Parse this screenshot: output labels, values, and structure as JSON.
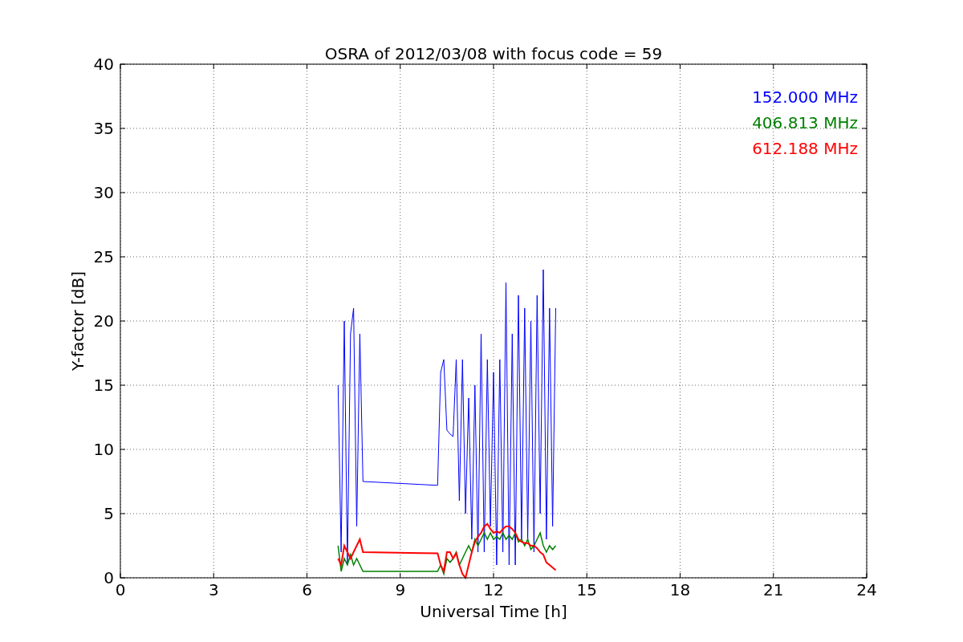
{
  "chart_data": {
    "type": "line",
    "title": "OSRA of 2012/03/08 with focus code = 59",
    "xlabel": "Universal Time [h]",
    "ylabel": "Y-factor [dB]",
    "x": [
      7.0,
      7.1,
      7.2,
      7.3,
      7.4,
      7.5,
      7.6,
      7.7,
      7.8,
      10.2,
      10.3,
      10.4,
      10.5,
      10.6,
      10.7,
      10.8,
      10.9,
      11.0,
      11.1,
      11.2,
      11.3,
      11.4,
      11.5,
      11.6,
      11.7,
      11.8,
      11.9,
      12.0,
      12.1,
      12.2,
      12.3,
      12.4,
      12.5,
      12.6,
      12.7,
      12.8,
      12.9,
      13.0,
      13.1,
      13.2,
      13.3,
      13.4,
      13.5,
      13.6,
      13.7,
      13.8,
      13.9,
      14.0
    ],
    "series": [
      {
        "name": "152.000 MHz",
        "color": "#0000ff",
        "values": [
          15,
          2,
          20,
          1,
          19,
          21,
          4,
          19,
          7.5,
          7.2,
          16,
          17,
          11.5,
          11.2,
          11,
          17,
          6,
          17,
          5,
          14,
          3,
          15,
          2,
          19,
          2,
          17,
          4,
          16,
          1,
          17,
          2,
          23,
          1,
          19,
          1,
          22,
          3,
          21,
          3,
          20,
          2,
          22,
          5,
          24,
          3,
          21,
          4,
          21
        ]
      },
      {
        "name": "406.813 MHz",
        "color": "#008000",
        "values": [
          2.5,
          0.5,
          1.5,
          1,
          1.8,
          1,
          1.5,
          1,
          0.5,
          0.5,
          1,
          0.3,
          1.5,
          1.2,
          1.5,
          2,
          1,
          1.5,
          2,
          2.5,
          2,
          3,
          2.5,
          3,
          3.5,
          3,
          3.5,
          3,
          3.2,
          3,
          3.5,
          3,
          3.3,
          3,
          3.5,
          2.8,
          3,
          2.5,
          3,
          2.2,
          2.5,
          3,
          3.5,
          2.5,
          2,
          2.5,
          2.2,
          2.5
        ]
      },
      {
        "name": "612.188 MHz",
        "color": "#ff0000",
        "values": [
          1.5,
          1,
          2.5,
          2,
          1.5,
          2,
          2.5,
          3,
          2,
          1.9,
          1,
          0.5,
          2,
          2,
          1.5,
          1.9,
          1,
          0.3,
          0,
          1,
          2,
          2.8,
          3.2,
          3.5,
          4,
          4.2,
          3.8,
          3.5,
          3.6,
          3.5,
          3.8,
          4,
          4,
          3.8,
          3.5,
          3,
          2.8,
          2.7,
          2.7,
          2.5,
          2.5,
          2.3,
          2,
          1.8,
          1.2,
          1,
          0.8,
          0.6
        ]
      }
    ],
    "grid": true,
    "xlim": [
      0,
      24
    ],
    "ylim": [
      0,
      40
    ],
    "xticks": [
      0,
      3,
      6,
      9,
      12,
      15,
      18,
      21,
      24
    ],
    "yticks": [
      0,
      5,
      10,
      15,
      20,
      25,
      30,
      35,
      40
    ]
  }
}
